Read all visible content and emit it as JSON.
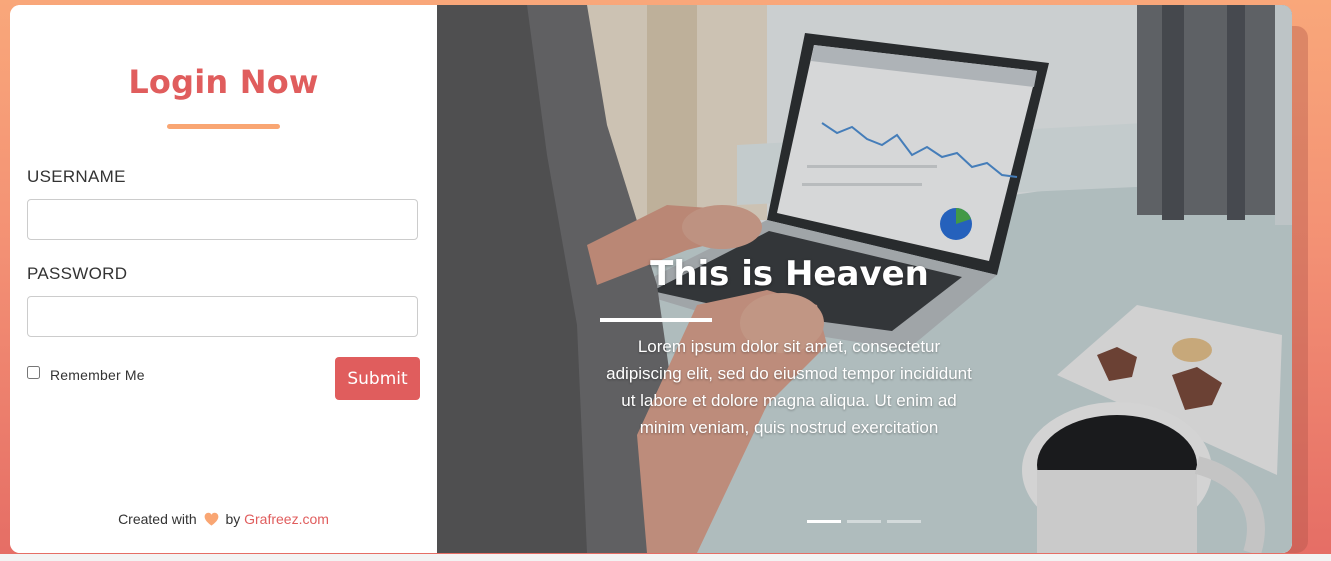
{
  "login": {
    "title": "Login Now",
    "username_label": "USERNAME",
    "username_value": "",
    "password_label": "PASSWORD",
    "password_value": "",
    "remember_label": "Remember Me",
    "remember_checked": false,
    "submit_label": "Submit"
  },
  "footer": {
    "prefix": "Created with",
    "heart_icon": "heart-icon",
    "by": "by",
    "link_text": "Grafreez.com"
  },
  "hero": {
    "title": "This is Heaven",
    "text": "Lorem ipsum dolor sit amet, consectetur adipiscing elit, sed do eiusmod tempor incididunt ut labore et dolore magna aliqua. Ut enim ad minim veniam, quis nostrud exercitation",
    "slides": 3,
    "active_slide": 1
  },
  "colors": {
    "accent": "#e05d5d",
    "underline": "#f9a673",
    "heart": "#f9a673",
    "background_top": "#f9a77a",
    "background_bottom": "#e56d65"
  }
}
